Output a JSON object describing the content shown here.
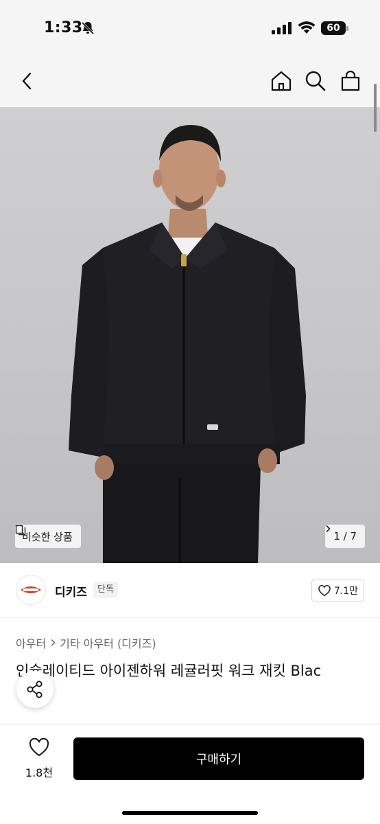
{
  "status_bar": {
    "time": "1:33",
    "battery": "60"
  },
  "nav": {
    "back_icon": "chevron-left-icon",
    "home_icon": "home-icon",
    "search_icon": "search-icon",
    "cart_icon": "shopping-bag-icon"
  },
  "hero": {
    "similar_label": "비슷한 상품",
    "page_indicator": "1 / 7"
  },
  "brand": {
    "name": "디키즈",
    "badge": "단독",
    "likes": "7.1만"
  },
  "product": {
    "breadcrumb": [
      "아우터",
      "기타 아우터 (디키즈)"
    ],
    "title": "인슐레이티드 아이젠하워 레귤러핏 워크 재킷 Blac"
  },
  "bottom": {
    "wish_count": "1.8천",
    "buy_label": "구매하기"
  },
  "colors": {
    "accent": "#000000",
    "background": "#ffffff",
    "status_bar_bg": "#f5f5f5"
  }
}
